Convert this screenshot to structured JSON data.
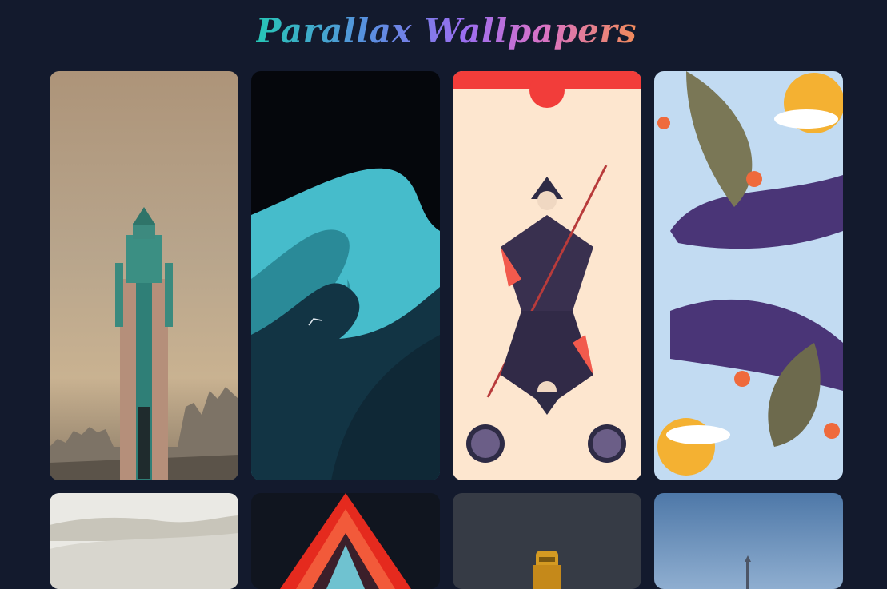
{
  "header": {
    "title": "Parallax Wallpapers"
  },
  "wallpapers": [
    {
      "name": "art-deco-tower",
      "colors": [
        "#b49a7c",
        "#3e8c80"
      ]
    },
    {
      "name": "dune-wave",
      "colors": [
        "#05070c",
        "#3fb8c8"
      ]
    },
    {
      "name": "knight-card",
      "colors": [
        "#fde6cf",
        "#f43b3b"
      ]
    },
    {
      "name": "flower-leaves",
      "colors": [
        "#bfd9f1",
        "#4a3675"
      ]
    },
    {
      "name": "misty-hills",
      "colors": [
        "#e9e8e3"
      ]
    },
    {
      "name": "red-triangle",
      "colors": [
        "#0f1420",
        "#e8281f"
      ]
    },
    {
      "name": "golden-statue",
      "colors": [
        "#363b45",
        "#d49a22"
      ]
    },
    {
      "name": "blue-sky-tower",
      "colors": [
        "#6a8db9"
      ]
    }
  ]
}
